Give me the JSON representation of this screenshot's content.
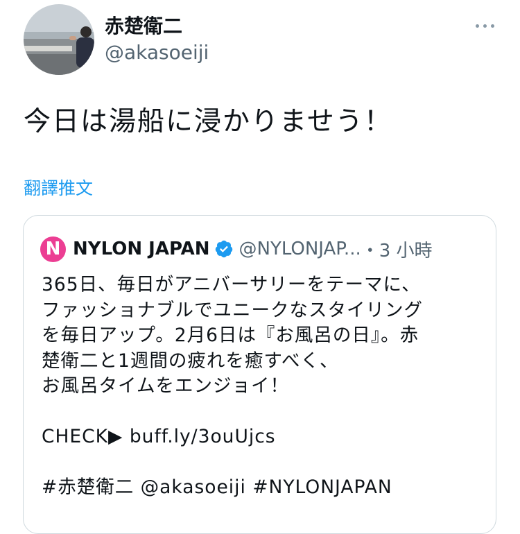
{
  "author": {
    "display_name": "赤楚衛二",
    "handle": "@akasoeiji"
  },
  "tweet": {
    "text": "今日は湯船に浸かりませう！",
    "translate_label": "翻譯推文"
  },
  "quoted_tweet": {
    "display_name": "NYLON JAPAN",
    "logo_letter": "N",
    "handle": "@NYLONJAP...",
    "time": "・3 小時",
    "lines": [
      "365日、毎日がアニバーサリーをテーマに、",
      "ファッショナブルでユニークなスタイリング",
      "を毎日アップ。2月6日は『お風呂の日』。赤",
      "楚衛二と1週間の疲れを癒すべく、",
      "お風呂タイムをエンジョイ！"
    ],
    "link_line": "CHECK▶ buff.ly/3ouUjcs",
    "tags_line": "#赤楚衛二 @akasoeiji #NYLONJAPAN"
  },
  "colors": {
    "link": "#1d9bf0",
    "muted": "#536471",
    "brand": "#ec3e93"
  }
}
